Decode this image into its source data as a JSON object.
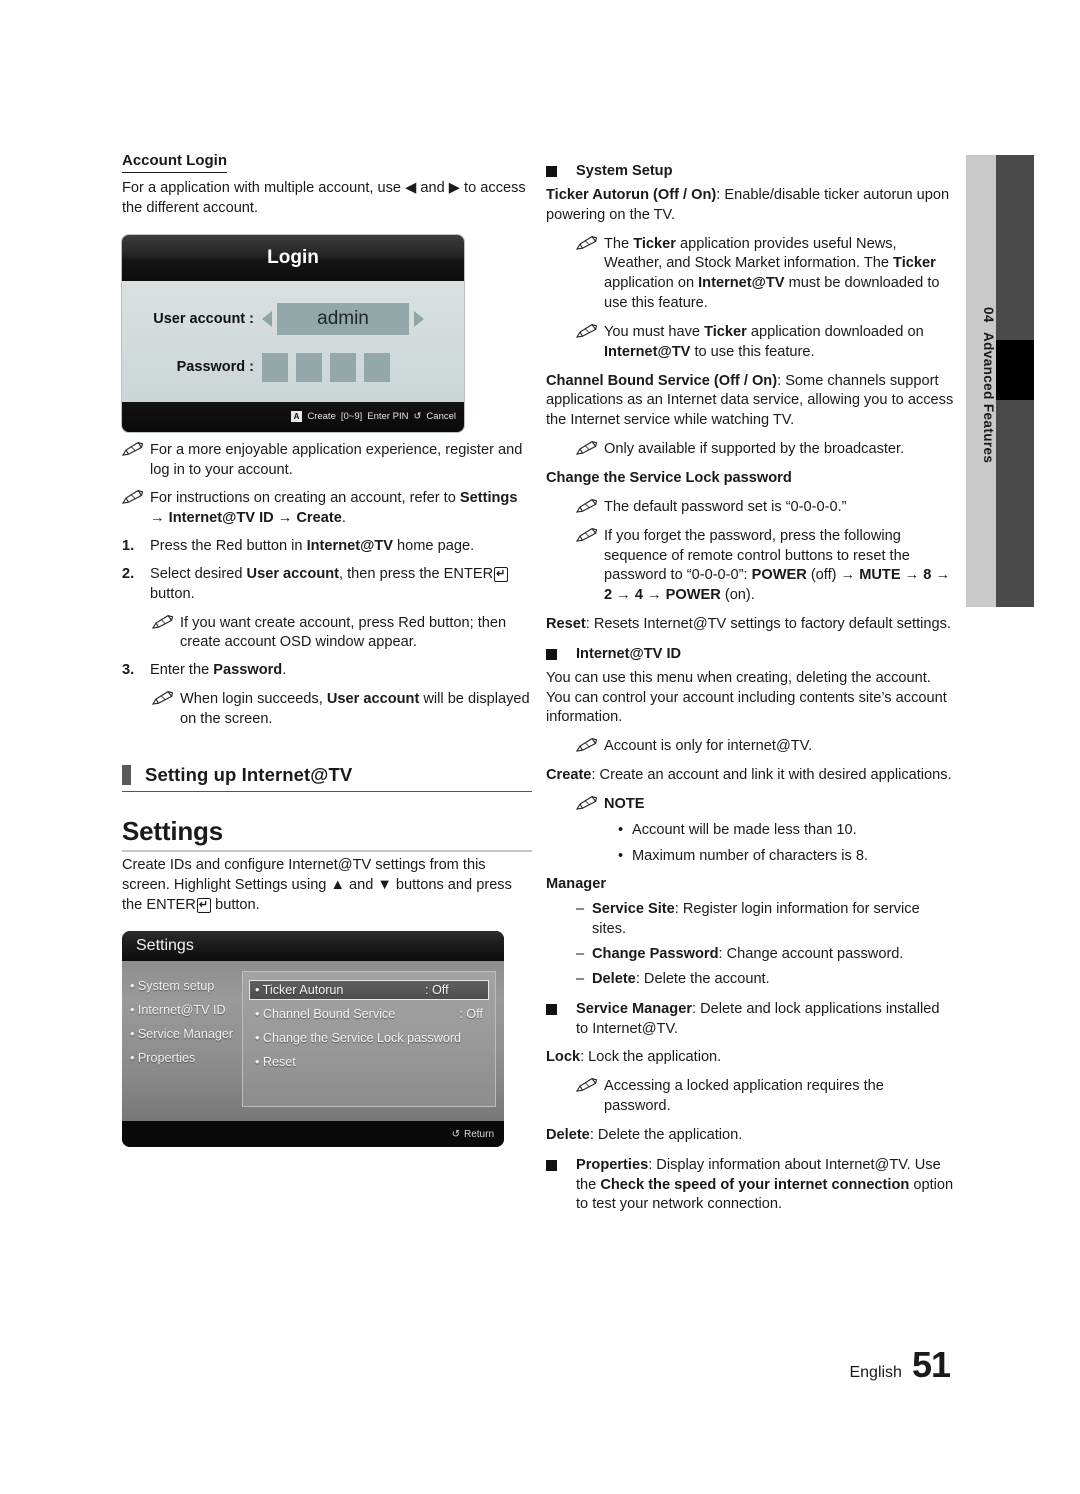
{
  "page": {
    "number": "51",
    "language": "English",
    "side_tab": {
      "chapter_number": "04",
      "chapter_title": "Advanced Features"
    }
  },
  "left": {
    "account_login": {
      "heading": "Account Login",
      "intro": "For a application with multiple account, use ◀ and ▶ to access the different account.",
      "osd": {
        "title": "Login",
        "user_account_label": "User account :",
        "user_account_value": "admin",
        "password_label": "Password :",
        "pin_count": 4,
        "footer": {
          "key_a": "A",
          "create": "Create",
          "digits": "[0~9]",
          "enter_pin": "Enter PIN",
          "return_glyph": "↺",
          "cancel": "Cancel"
        }
      },
      "note1": "For a more enjoyable application experience, register and log in to your account.",
      "note2_plain": "For instructions on creating an account, refer to ",
      "note2_bold": "Settings → Internet@TV ID → Create",
      "note2_end": ".",
      "step1_num": "1.",
      "step1_a": "Press the Red button in ",
      "step1_b": "Internet@TV",
      "step1_c": " home page.",
      "step2_num": "2.",
      "step2_a": "Select desired ",
      "step2_b": "User account",
      "step2_c": ", then press the ENTER",
      "step2_d": " button.",
      "step2_note": "If you want create account, press Red button; then create account OSD window appear.",
      "step3_num": "3.",
      "step3_a": "Enter the ",
      "step3_b": "Password",
      "step3_c": ".",
      "step3_note_a": "When login succeeds, ",
      "step3_note_b": "User account",
      "step3_note_c": " will be displayed on the screen."
    },
    "setting_up": {
      "title": "Setting up Internet@TV"
    },
    "settings": {
      "title": "Settings",
      "intro_a": "Create IDs and configure Internet@TV settings from this screen. Highlight Settings using ▲ and ▼ buttons and press the ENTER",
      "intro_b": " button.",
      "osd": {
        "title": "Settings",
        "left_menu": [
          "• System setup",
          "• Internet@TV ID",
          "• Service Manager",
          "• Properties"
        ],
        "items": [
          {
            "name": "• Ticker Autorun",
            "value": ": Off",
            "selected": true
          },
          {
            "name": "• Channel Bound Service",
            "value": ": Off",
            "selected": false
          },
          {
            "name": "• Change the Service Lock password",
            "value": "",
            "selected": false
          },
          {
            "name": "• Reset",
            "value": "",
            "selected": false
          }
        ],
        "return_glyph": "↺",
        "return_label": "Return"
      }
    }
  },
  "right": {
    "system_setup": {
      "heading": "System Setup",
      "ticker_bold": "Ticker Autorun (Off / On)",
      "ticker_rest": ": Enable/disable ticker autorun upon powering on the TV.",
      "ticker_note1_a": "The ",
      "ticker_note1_b": "Ticker",
      "ticker_note1_c": " application provides useful News, Weather, and Stock Market information. The ",
      "ticker_note1_d": "Ticker",
      "ticker_note1_e": " application on ",
      "ticker_note1_f": "Internet@TV",
      "ticker_note1_g": " must be downloaded to use this feature.",
      "ticker_note2_a": "You must have ",
      "ticker_note2_b": "Ticker",
      "ticker_note2_c": " application downloaded on ",
      "ticker_note2_d": "Internet@TV",
      "ticker_note2_e": " to use this feature.",
      "cbs_bold": "Channel Bound Service (Off / On)",
      "cbs_rest": ": Some channels support applications as an Internet data service, allowing you to access the Internet service while watching TV.",
      "cbs_note": "Only available if supported by the broadcaster.",
      "lock_heading": "Change the Service Lock password",
      "lock_note1": "The default password set is “0-0-0-0.”",
      "lock_note2_a": "If you forget the password, press the following sequence of remote control buttons to reset the password to “0-0-0-0”: ",
      "lock_note2_power_off": "POWER",
      "lock_note2_off": " (off) → ",
      "lock_note2_mute": "MUTE",
      "lock_note2_seq": " → 8 → 2 → 4 → ",
      "lock_note2_power_on": "POWER",
      "lock_note2_on": " (on).",
      "reset_bold": "Reset",
      "reset_rest": ": Resets Internet@TV settings to factory default settings."
    },
    "internet_tv_id": {
      "heading": "Internet@TV ID",
      "para": "You can use this menu when creating, deleting the account. You can control your account including contents site’s account information.",
      "note": "Account is only for internet@TV.",
      "create_bold": "Create",
      "create_rest": ": Create an account and link it with desired applications.",
      "note_label": "NOTE",
      "note_items": [
        "Account will be made less than 10.",
        "Maximum number of characters is 8."
      ],
      "manager_heading": "Manager",
      "manager_items": [
        {
          "bold": "Service Site",
          "rest": ": Register login information for service sites."
        },
        {
          "bold": "Change Password",
          "rest": ": Change account password."
        },
        {
          "bold": "Delete",
          "rest": ": Delete the account."
        }
      ]
    },
    "service_manager": {
      "bold": "Service Manager",
      "rest": ": Delete and lock applications installed to Internet@TV.",
      "lock_bold": "Lock",
      "lock_rest": ": Lock the application.",
      "lock_note": "Accessing a locked application requires the password.",
      "delete_bold": "Delete",
      "delete_rest": ": Delete the application."
    },
    "properties": {
      "bold": "Properties",
      "rest_a": ": Display information about Internet@TV. Use the ",
      "rest_bold": "Check the speed of your internet connection",
      "rest_b": " option to test your network connection."
    }
  }
}
